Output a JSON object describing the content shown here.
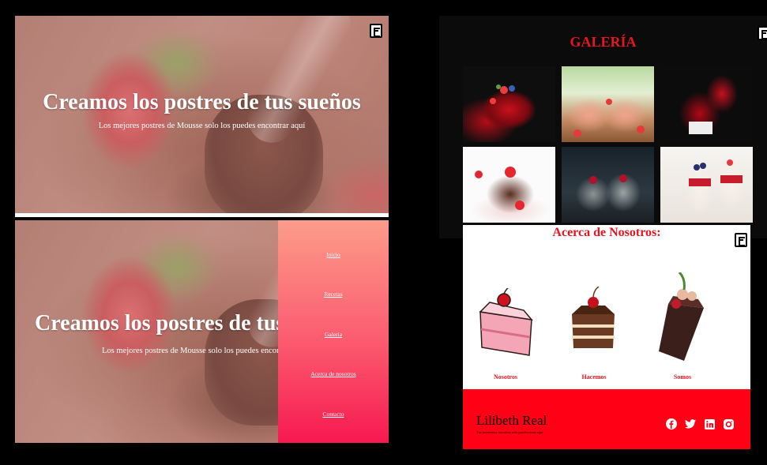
{
  "hero": {
    "title": "Creamos los postres de tus sueños",
    "subtitle": "Los mejores postres de Mousse solo los puedes encontrar aquí"
  },
  "menu": {
    "items": [
      {
        "label": "Inicio"
      },
      {
        "label": "Recetas"
      },
      {
        "label": "Galeria"
      },
      {
        "label": "Acerca de nosotros"
      },
      {
        "label": "Contacto"
      }
    ]
  },
  "gallery": {
    "title": "GALERÍA"
  },
  "about": {
    "title": "Acerca de Nosotros:",
    "cards": [
      {
        "label": "Nosotros"
      },
      {
        "label": "Hacemos"
      },
      {
        "label": "Somos"
      }
    ]
  },
  "footer": {
    "name": "Lilibeth Real",
    "tagline": "Tus momentos favoritos solo puedes estar aquí",
    "social": [
      "facebook-icon",
      "twitter-icon",
      "linkedin-icon",
      "instagram-icon"
    ]
  },
  "colors": {
    "accent_red": "#e8141f",
    "footer_red": "#ff0015",
    "menu_top": "#fc9c8a",
    "menu_bottom": "#f7194f"
  }
}
